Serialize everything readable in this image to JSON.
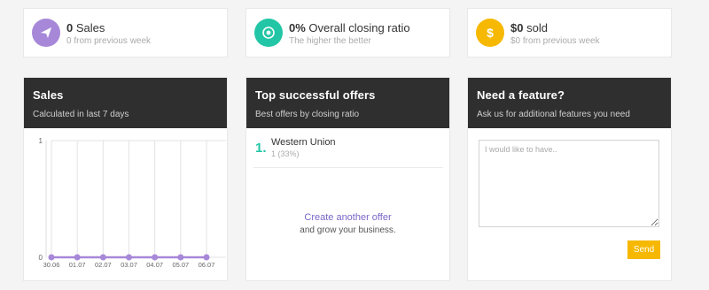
{
  "stats": [
    {
      "value": "0",
      "label": "Sales",
      "sub": "0 from previous week",
      "color": "#a788d8",
      "icon": "paper-plane-icon"
    },
    {
      "value": "0%",
      "label": "Overall closing ratio",
      "sub": "The higher the better",
      "color": "#22c6a6",
      "icon": "target-icon"
    },
    {
      "value": "$0",
      "label": "sold",
      "sub": "$0 from previous week",
      "color": "#f6b800",
      "icon": "dollar-icon"
    }
  ],
  "sales_card": {
    "title": "Sales",
    "subtitle": "Calculated in last 7 days"
  },
  "offers_card": {
    "title": "Top successful offers",
    "subtitle": "Best offers by closing ratio",
    "offers": [
      {
        "rank": "1.",
        "name": "Western Union",
        "ratio": "1 (33%)"
      }
    ],
    "create_link": "Create another offer",
    "create_sub": "and grow your business."
  },
  "feature_card": {
    "title": "Need a feature?",
    "subtitle": "Ask us for additional features you need",
    "placeholder": "I would like to have..",
    "send_label": "Send"
  },
  "chart_data": {
    "type": "line",
    "categories": [
      "30.06",
      "01.07",
      "02.07",
      "03.07",
      "04.07",
      "05.07",
      "06.07"
    ],
    "values": [
      0,
      0,
      0,
      0,
      0,
      0,
      0
    ],
    "ylim": [
      0,
      1
    ],
    "yticks": [
      "0",
      "1"
    ],
    "grid": true,
    "color": "#a788d8"
  }
}
